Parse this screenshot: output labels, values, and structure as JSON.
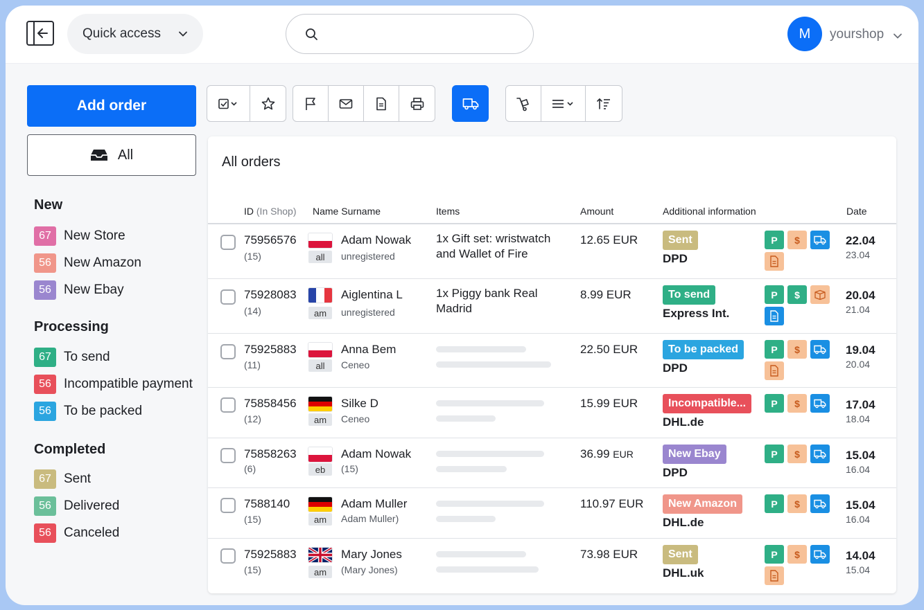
{
  "topbar": {
    "quick_access": "Quick access",
    "search_placeholder": "",
    "avatar_letter": "M",
    "username": "yourshop"
  },
  "sidebar": {
    "add_order": "Add order",
    "all": "All",
    "sections": [
      {
        "title": "New",
        "items": [
          {
            "count": "67",
            "label": "New Store",
            "color": "#e06fa6"
          },
          {
            "count": "56",
            "label": "New Amazon",
            "color": "#f0968a"
          },
          {
            "count": "56",
            "label": "New Ebay",
            "color": "#9a86cf"
          }
        ]
      },
      {
        "title": "Processing",
        "items": [
          {
            "count": "67",
            "label": "To send",
            "color": "#2faf86"
          },
          {
            "count": "56",
            "label": "Incompatible payment",
            "color": "#e8505b"
          },
          {
            "count": "56",
            "label": "To be packed",
            "color": "#2ba5e0"
          }
        ]
      },
      {
        "title": "Completed",
        "items": [
          {
            "count": "67",
            "label": "Sent",
            "color": "#c9bb7f"
          },
          {
            "count": "56",
            "label": "Delivered",
            "color": "#6bbf9a"
          },
          {
            "count": "56",
            "label": "Canceled",
            "color": "#e8505b"
          }
        ]
      }
    ]
  },
  "table": {
    "title": "All orders",
    "headers": {
      "id": "ID",
      "id_sub": "(In Shop)",
      "name": "Name Surname",
      "items": "Items",
      "amount": "Amount",
      "info": "Additional information",
      "date": "Date"
    },
    "rows": [
      {
        "id": "75956576",
        "sub": "(15)",
        "flag": "pl",
        "shop": "all",
        "name": "Adam Nowak",
        "name_sub": "unregistered",
        "items": "1x Gift set: wristwatch and Wallet of Fire",
        "amount": "12.65 EUR",
        "status": "Sent",
        "status_color": "#c9bb7f",
        "carrier": "DPD",
        "date": "22.04",
        "date2": "23.04"
      },
      {
        "id": "75928083",
        "sub": "(14)",
        "flag": "fr",
        "shop": "am",
        "name": "Aiglentina L",
        "name_sub": "unregistered",
        "items": "1x Piggy bank Real Madrid",
        "amount": "8.99 EUR",
        "status": "To send",
        "status_color": "#2faf86",
        "carrier": "Express Int.",
        "date": "20.04",
        "date2": "21.04"
      },
      {
        "id": "75925883",
        "sub": "(11)",
        "flag": "pl",
        "shop": "all",
        "name": "Anna Bem",
        "name_sub": "Ceneo",
        "items": "",
        "amount": "22.50 EUR",
        "status": "To be packed",
        "status_color": "#2ba5e0",
        "carrier": "DPD",
        "date": "19.04",
        "date2": "20.04"
      },
      {
        "id": "75858456",
        "sub": "(12)",
        "flag": "de",
        "shop": "am",
        "name": "Silke D",
        "name_sub": "Ceneo",
        "items": "",
        "amount": "15.99 EUR",
        "status": "Incompatible...",
        "status_color": "#e8505b",
        "carrier": "DHL.de",
        "date": "17.04",
        "date2": "18.04"
      },
      {
        "id": "75858263",
        "sub": "(6)",
        "flag": "pl",
        "shop": "eb",
        "name": "Adam Nowak",
        "name_sub": "(15)",
        "items": "",
        "amount_value": "36.99",
        "amount_cur": "EUR",
        "status": "New Ebay",
        "status_color": "#9a86cf",
        "carrier": "DPD",
        "date": "15.04",
        "date2": "16.04"
      },
      {
        "id": "7588140",
        "sub": "(15)",
        "flag": "de",
        "shop": "am",
        "name": "Adam Muller",
        "name_sub": "Adam Muller)",
        "items": "",
        "amount": "110.97 EUR",
        "status": "New Amazon",
        "status_color": "#f0968a",
        "carrier": "DHL.de",
        "date": "15.04",
        "date2": "16.04"
      },
      {
        "id": "75925883",
        "sub": "(15)",
        "flag": "uk",
        "shop": "am",
        "name": "Mary Jones",
        "name_sub": "(Mary Jones)",
        "items": "",
        "amount": "73.98 EUR",
        "status": "Sent",
        "status_color": "#c9bb7f",
        "carrier": "DHL.uk",
        "date": "14.04",
        "date2": "15.04"
      }
    ],
    "icon_labels": {
      "p": "P",
      "usd": "$"
    }
  }
}
